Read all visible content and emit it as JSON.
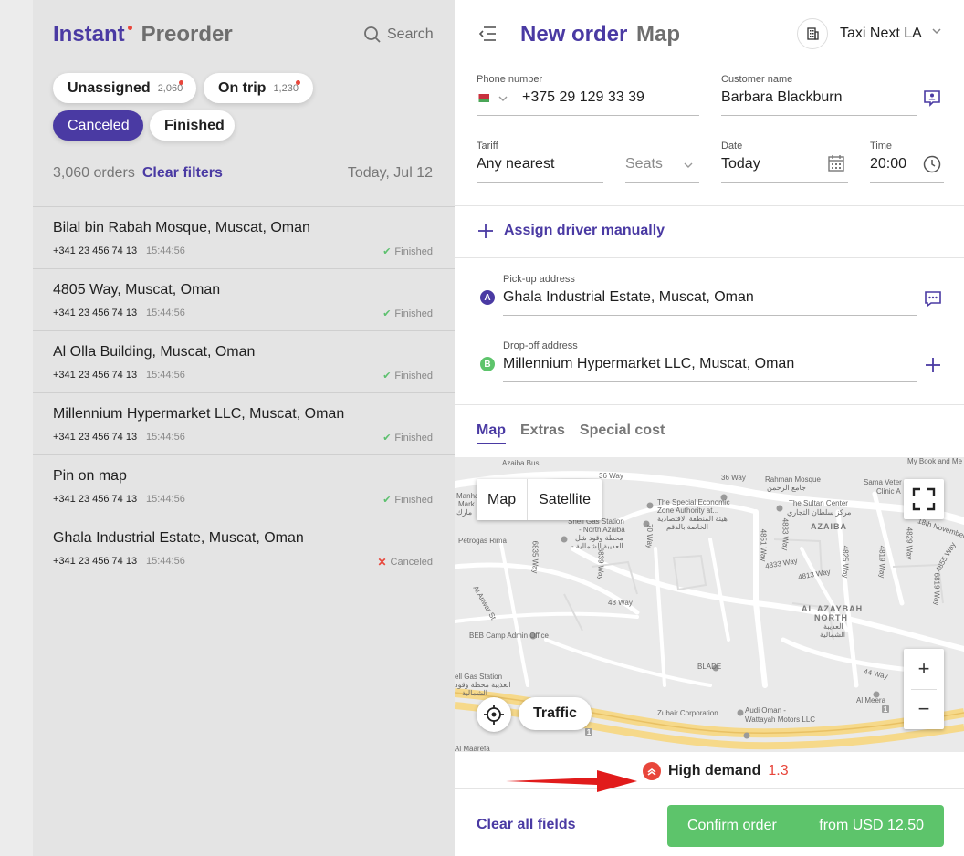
{
  "left": {
    "tabs": {
      "instant": "Instant",
      "preorder": "Preorder"
    },
    "search_label": "Search",
    "filters": [
      {
        "label": "Unassigned",
        "count": "2,060"
      },
      {
        "label": "On trip",
        "count": "1,230"
      },
      {
        "label": "Canceled"
      },
      {
        "label": "Finished"
      }
    ],
    "orders_count": "3,060 orders",
    "clear_filters": "Clear filters",
    "date": "Today, Jul 12",
    "orders": [
      {
        "address": "Bilal bin Rabah Mosque, Muscat, Oman",
        "phone": "+341 23 456 74 13",
        "time": "15:44:56",
        "status": "Finished"
      },
      {
        "address": "4805 Way, Muscat, Oman",
        "phone": "+341 23 456 74 13",
        "time": "15:44:56",
        "status": "Finished"
      },
      {
        "address": "Al Olla Building, Muscat, Oman",
        "phone": "+341 23 456 74 13",
        "time": "15:44:56",
        "status": "Finished"
      },
      {
        "address": "Millennium Hypermarket LLC, Muscat, Oman",
        "phone": "+341 23 456 74 13",
        "time": "15:44:56",
        "status": "Finished"
      },
      {
        "address": "Pin on map",
        "phone": "+341 23 456 74 13",
        "time": "15:44:56",
        "status": "Finished"
      },
      {
        "address": "Ghala Industrial Estate, Muscat, Oman",
        "phone": "+341 23 456 74 13",
        "time": "15:44:56",
        "status": "Canceled"
      }
    ]
  },
  "right": {
    "tabs": {
      "new_order": "New order",
      "map": "Map"
    },
    "org_name": "Taxi Next LA",
    "form": {
      "phone_label": "Phone number",
      "phone_value": "+375 29 129 33 39",
      "customer_label": "Customer name",
      "customer_value": "Barbara Blackburn",
      "tariff_label": "Tariff",
      "tariff_value": "Any nearest",
      "seats_placeholder": "Seats",
      "date_label": "Date",
      "date_value": "Today",
      "time_label": "Time",
      "time_value": "20:00"
    },
    "assign_driver": "Assign driver manually",
    "pickup": {
      "label": "Pick-up address",
      "badge": "A",
      "value": "Ghala Industrial Estate, Muscat, Oman"
    },
    "dropoff": {
      "label": "Drop-off address",
      "badge": "B",
      "value": "Millennium Hypermarket LLC, Muscat, Oman"
    },
    "subtabs": [
      "Map",
      "Extras",
      "Special cost"
    ],
    "map": {
      "type_map": "Map",
      "type_satellite": "Satellite",
      "traffic": "Traffic",
      "labels": {
        "azaiba_bus": "Azaiba Bus",
        "way36a": "36 Way",
        "way36b": "36 Way",
        "rahman_mosque": "Rahman Mosque",
        "rahman_ar": "جامع الرحمن",
        "my_book": "My Book and Me",
        "sama_veter": "Sama Veter",
        "clinic": "Clinic A",
        "special_economic": "The Special Economic",
        "zone_authority": "Zone Authority at...",
        "zone_ar1": "هيئة المنطقة الاقتصادية",
        "zone_ar2": "الخاصة بالدقم",
        "sultan_center": "The Sultan Center",
        "sultan_ar": "مركز سلطان التجاري",
        "shell_station": "Shell Gas Station",
        "north_azaiba": "- North Azaiba",
        "shell_ar1": "محطة وقود شل",
        "shell_ar2": "- العذيبة الشمالية",
        "petrogas": "Petrogas Rima",
        "manha": "Manha",
        "mark": "Mark",
        "manha_ar": "مارك",
        "azaiba": "AZAIBA",
        "nov18": "18th November St",
        "way48": "48 Way",
        "al_azaybah": "AL AZAYBAH",
        "north": "NORTH",
        "north_ar1": "العذيبة",
        "north_ar2": "الشمالية",
        "al_anwar": "Al Anwar St",
        "beb_camp": "BEB Camp Admin Office",
        "blade": "BLADE",
        "way44": "44 Way",
        "gas_station": "ell Gas Station",
        "gas_ar1": "العذيبة محطة وقود",
        "gas_ar2": "الشمالية",
        "zubair": "Zubair Corporation",
        "audi": "Audi Oman -",
        "wattayah": "Wattayah Motors LLC",
        "al_meera": "Al Meera",
        "al_maarefa": "Al Maarefa",
        "way6835": "6835 Way",
        "way6839": "6839 Way",
        "way4851": "4851 Way",
        "way4833": "4833 Way",
        "way70": "70 Way",
        "way6819": "6819 Way",
        "way4833b": "4833 Way",
        "way4813": "4813 Way",
        "way4819": "4819 Way",
        "way4825": "4825 Way",
        "way4829": "4829 Way",
        "road1": "1",
        "road1b": "1",
        "way4855": "4855 Way"
      }
    },
    "demand": {
      "label": "High demand",
      "value": "1.3"
    },
    "clear_all": "Clear all fields",
    "confirm": {
      "label": "Confirm order",
      "price": "from USD 12.50"
    }
  },
  "colors": {
    "accent": "#4a3aa3",
    "danger": "#e8463b",
    "success": "#5dc46b"
  }
}
